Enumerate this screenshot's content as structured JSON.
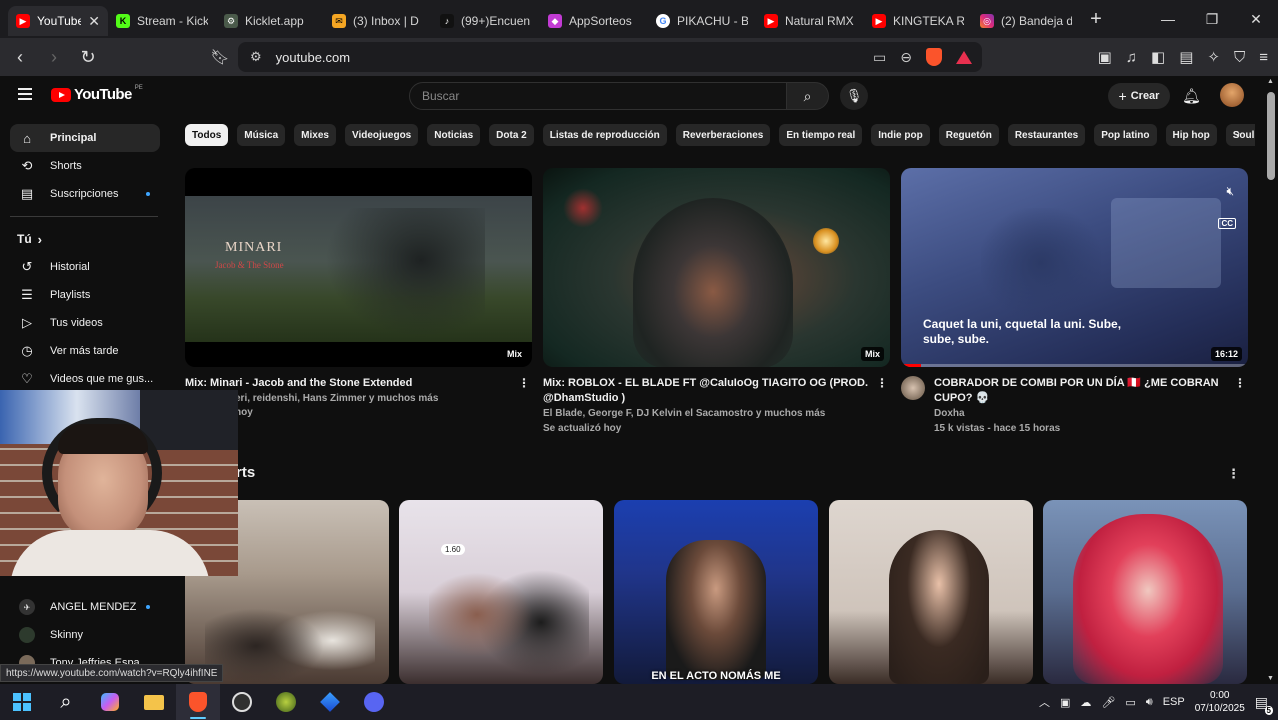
{
  "browser": {
    "tabs": [
      {
        "title": "YouTube",
        "color": "#ff0000",
        "glyph": "▶",
        "active": true
      },
      {
        "title": "Stream - Kick",
        "color": "#53fc18",
        "glyph": "K"
      },
      {
        "title": "Kicklet.app",
        "color": "#4a5a4a",
        "glyph": "⚙"
      },
      {
        "title": "(3) Inbox | D",
        "color": "#f5a623",
        "glyph": "✉"
      },
      {
        "title": "(99+)Encuen",
        "color": "#111111",
        "glyph": "♪"
      },
      {
        "title": "AppSorteos",
        "color": "#c23bd4",
        "glyph": "◆"
      },
      {
        "title": "PIKACHU - B",
        "color": "#ffffff",
        "glyph": "G"
      },
      {
        "title": "Natural RMX",
        "color": "#ff0000",
        "glyph": "▶"
      },
      {
        "title": "KINGTEKA R",
        "color": "#ff0000",
        "glyph": "▶"
      },
      {
        "title": "(2) Bandeja d",
        "color": "#d62976",
        "glyph": "◎"
      }
    ],
    "url": "youtube.com",
    "status_url": "https://www.youtube.com/watch?v=RQly4ihfINE"
  },
  "youtube": {
    "logo_text": "YouTube",
    "country": "PE",
    "search_placeholder": "Buscar",
    "create_label": "Crear",
    "sidebar": {
      "main": [
        {
          "label": "Principal",
          "icon": "home-icon",
          "glyph": "⌂",
          "active": true
        },
        {
          "label": "Shorts",
          "icon": "shorts-icon",
          "glyph": "⟲"
        },
        {
          "label": "Suscripciones",
          "icon": "subscriptions-icon",
          "glyph": "▤",
          "dot": true
        }
      ],
      "you_heading": "Tú",
      "you": [
        {
          "label": "Historial",
          "icon": "history-icon",
          "glyph": "↺"
        },
        {
          "label": "Playlists",
          "icon": "playlists-icon",
          "glyph": "☰"
        },
        {
          "label": "Tus videos",
          "icon": "your-videos-icon",
          "glyph": "▷"
        },
        {
          "label": "Ver más tarde",
          "icon": "watch-later-icon",
          "glyph": "◷"
        },
        {
          "label": "Videos que me gus...",
          "icon": "liked-videos-icon",
          "glyph": "👍"
        }
      ],
      "subscriptions": [
        {
          "label": "ANGEL MENDEZ",
          "dot": true
        },
        {
          "label": "Skinny"
        },
        {
          "label": "Tony Jeffries Espa..."
        }
      ]
    },
    "chips": [
      "Todos",
      "Música",
      "Mixes",
      "Videojuegos",
      "Noticias",
      "Dota 2",
      "Listas de reproducción",
      "Reverberaciones",
      "En tiempo real",
      "Indie pop",
      "Reguetón",
      "Restaurantes",
      "Pop latino",
      "Hip hop",
      "Soul"
    ],
    "videos": [
      {
        "title": "Mix: Minari - Jacob and the Stone Extended",
        "line1": "eri, reidenshi, Hans Zimmer y muchos más",
        "line2": "hoy",
        "badge": "Mix",
        "thumb_title": "MINARI",
        "thumb_sub": "Jacob & The Stone"
      },
      {
        "title": "Mix: ROBLOX - EL BLADE FT @CaluIoOg  TIAGITO OG (PROD. @DhamStudio )",
        "line1": "El Blade, George F, DJ Kelvin el Sacamostro y muchos más",
        "line2": "Se actualizó hoy",
        "badge": "Mix"
      },
      {
        "title": "COBRADOR DE COMBI POR UN DÍA 🇵🇪 ¿ME COBRAN CUPO? 💀",
        "channel": "Doxha",
        "line2": "15 k vistas - hace 15 horas",
        "badge": "16:12",
        "caption": "Caquet la uni, cquetal la uni. Sube, sube, sube."
      }
    ],
    "shorts_heading": "rts",
    "shorts": [
      {
        "caption": ""
      },
      {
        "caption": "",
        "tag": "1.60"
      },
      {
        "caption": "EN EL ACTO NOMÁS ME"
      },
      {
        "caption": ""
      },
      {
        "caption": ""
      }
    ]
  },
  "taskbar": {
    "time": "0:00",
    "date": "07/10/2025",
    "lang": "ESP",
    "notifications": "5"
  }
}
